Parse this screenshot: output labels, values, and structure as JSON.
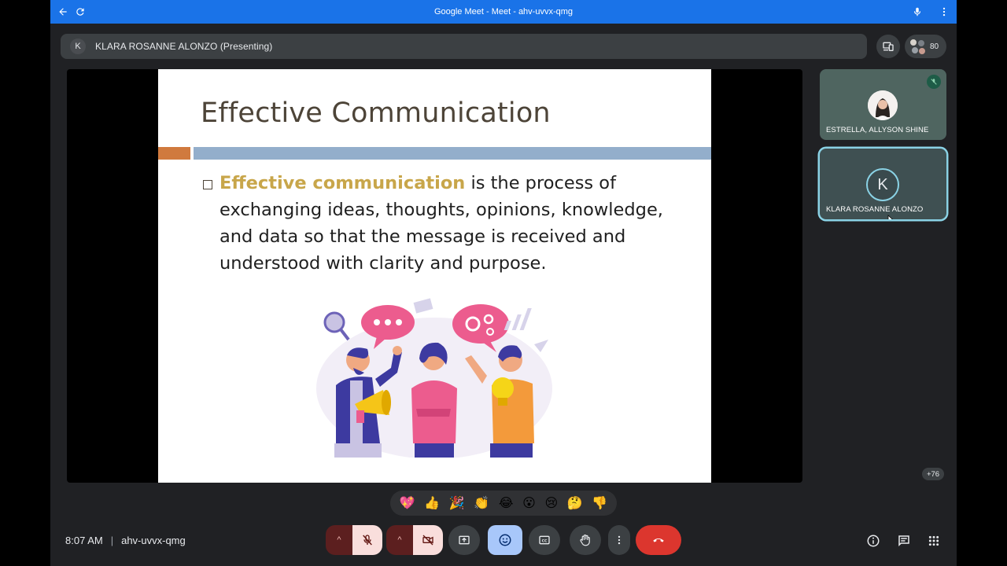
{
  "browser": {
    "title": "Google Meet - Meet - ahv-uvvx-qmg",
    "back_icon": "arrow-back-icon",
    "reload_icon": "reload-icon",
    "mic_icon": "microphone-icon",
    "menu_icon": "more-vert-icon",
    "bar_color": "#1a73e8"
  },
  "presenter": {
    "avatar_letter": "K",
    "label": "KLARA ROSANNE ALONZO (Presenting)"
  },
  "people": {
    "count": "80"
  },
  "slide": {
    "title": "Effective Communication",
    "highlight": "Effective communication",
    "body": " is the process of exchanging ideas, thoughts, opinions, knowledge, and data so that the message is received and understood with clarity and purpose.",
    "accent_orange": "#d07a3e",
    "accent_blue": "#93aecb",
    "highlight_color": "#c8a64a"
  },
  "participants": [
    {
      "name": "ESTRELLA, ALLYSON SHINE",
      "muted": true
    },
    {
      "name": "KLARA ROSANNE ALONZO",
      "avatar_letter": "K",
      "active_speaker": true
    }
  ],
  "more_participants": "+76",
  "reactions": [
    "💖",
    "👍",
    "🎉",
    "👏",
    "😂",
    "😮",
    "😢",
    "🤔",
    "👎"
  ],
  "meeting": {
    "time": "8:07 AM",
    "code": "ahv-uvvx-qmg"
  },
  "controls": {
    "mic_state": "muted",
    "camera_state": "off",
    "hangup_color": "#dc362e",
    "icons": [
      "present-screen-icon",
      "emoji-icon",
      "captions-icon",
      "raise-hand-icon",
      "more-options-icon",
      "end-call-icon"
    ]
  },
  "right_icons": [
    "info-icon",
    "chat-icon",
    "activities-icon"
  ]
}
